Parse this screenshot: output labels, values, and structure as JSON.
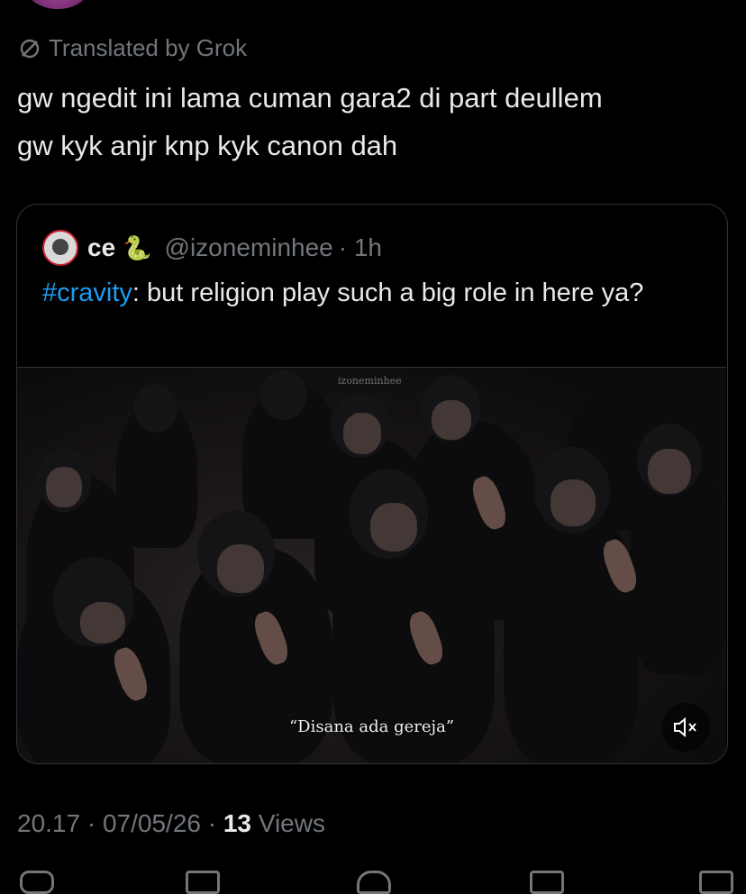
{
  "translation": {
    "label": "Translated by Grok"
  },
  "tweet": {
    "text_line1": "gw ngedit ini lama cuman gara2 di part deullem",
    "text_line2": "gw kyk anjr knp kyk canon dah"
  },
  "quote": {
    "name": "ce",
    "emoji": "🐍",
    "handle": "@izoneminhee",
    "time": "· 1h",
    "hashtag": "#cravity",
    "text": ": but religion play such a big role in here ya?",
    "media": {
      "watermark": "izoneminhee",
      "subtitle": "“Disana ada gereja”"
    }
  },
  "meta": {
    "time": "20.17",
    "sep1": " · ",
    "date": "07/05/26",
    "sep2": " · ",
    "views_count": "13",
    "views_label": " Views"
  },
  "icons": [
    "translate-icon",
    "mute-icon",
    "reply-icon",
    "repost-icon",
    "like-icon",
    "bookmark-icon",
    "share-icon"
  ]
}
